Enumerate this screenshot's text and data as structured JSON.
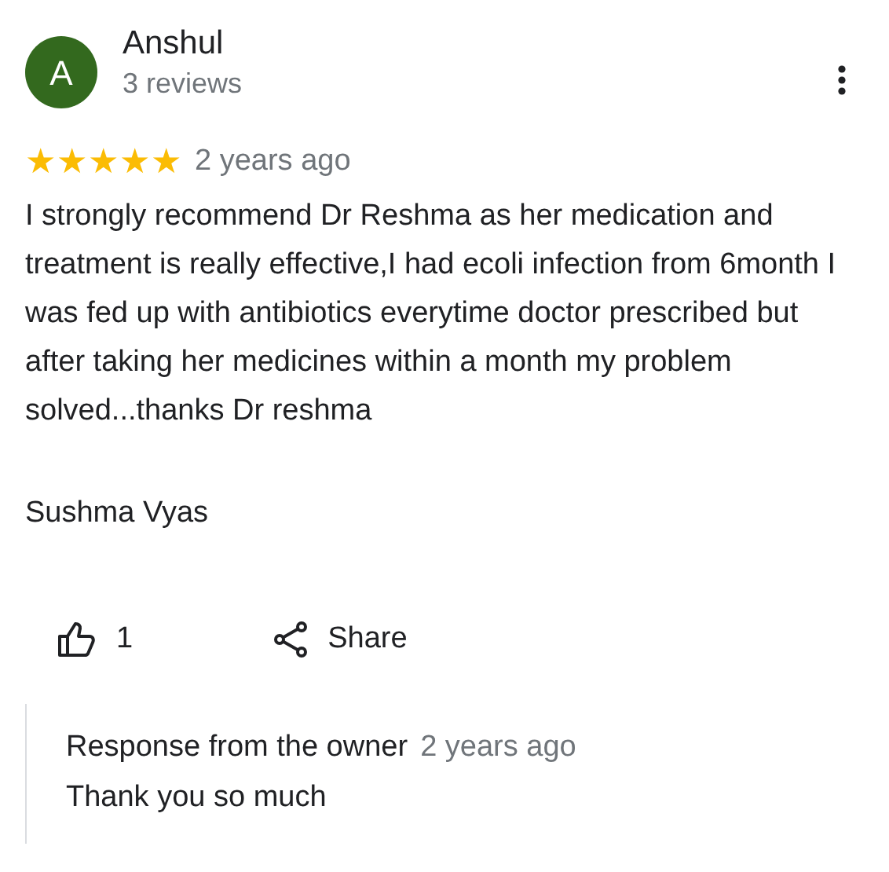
{
  "reviewer": {
    "initial": "A",
    "name": "Anshul",
    "reviews": "3 reviews"
  },
  "rating": {
    "stars": 5,
    "time": "2 years ago"
  },
  "review_text": "I strongly recommend Dr Reshma as her medication and treatment is really effective,I had ecoli infection from 6month I was fed up with antibiotics everytime doctor prescribed but after taking her medicines within a month my problem solved...thanks Dr reshma",
  "signature": "Sushma Vyas",
  "actions": {
    "like_count": "1",
    "share": "Share"
  },
  "owner_response": {
    "title": "Response from the owner",
    "time": "2 years ago",
    "text": "Thank you so much"
  }
}
